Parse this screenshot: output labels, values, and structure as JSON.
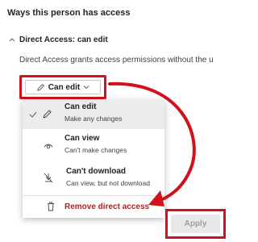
{
  "heading": "Ways this person has access",
  "section": {
    "title": "Direct Access: can edit",
    "description": "Direct Access grants access permissions without the u"
  },
  "dropdown": {
    "label": "Can edit",
    "icon": "pencil-icon",
    "options": [
      {
        "title": "Can edit",
        "subtitle": "Make any changes",
        "icon": "pencil-icon",
        "selected": true
      },
      {
        "title": "Can view",
        "subtitle": "Can't make changes",
        "icon": "eye-icon",
        "selected": false
      },
      {
        "title": "Can't download",
        "subtitle": "Can view, but not download",
        "icon": "no-download-icon",
        "selected": false
      }
    ],
    "remove_label": "Remove direct access",
    "remove_icon": "trash-icon"
  },
  "apply_label": "Apply",
  "colors": {
    "highlight_red": "#d1111b",
    "remove_text": "#a4262c",
    "selected_bg": "#ececec"
  }
}
